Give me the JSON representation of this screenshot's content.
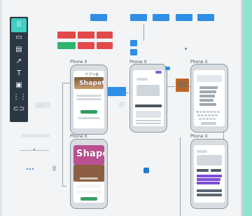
{
  "toolbar": {
    "tools": [
      {
        "name": "select-tool"
      },
      {
        "name": "sticky-note-tool"
      },
      {
        "name": "card-tool"
      },
      {
        "name": "arrow-tool"
      },
      {
        "name": "text-tool"
      },
      {
        "name": "image-tool"
      },
      {
        "name": "grid-tool"
      },
      {
        "name": "link-tool"
      }
    ]
  },
  "labels": {
    "phone1": "Phone X",
    "phone2": "Phone X",
    "phone3": "Phone X",
    "phone4": "Phone X",
    "phone5": "Phone X",
    "shapet_big": "Shapet",
    "shapet_small": "Shapet"
  }
}
